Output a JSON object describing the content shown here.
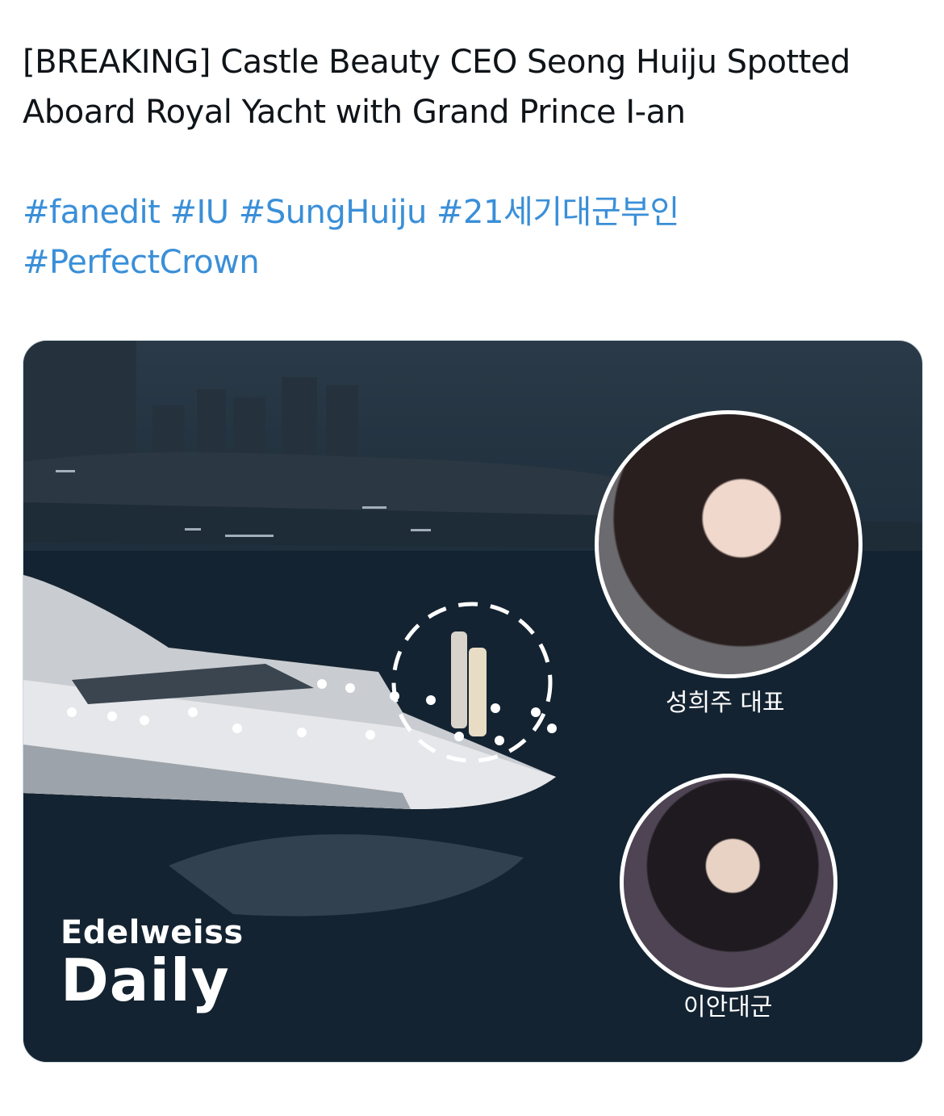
{
  "tweet": {
    "headline_line1": "[BREAKING] Castle Beauty CEO Seong Huiju Spotted",
    "headline_line2": "Aboard Royal Yacht with Grand Prince I-an",
    "hashtags_line1": [
      "#fanedit",
      "#IU",
      "#SungHuiju",
      "#21세기대군부인"
    ],
    "hashtags_line2": [
      "#PerfectCrown"
    ],
    "hashtag_color": "#3a8fd8"
  },
  "media": {
    "portrait_ceo_caption": "성희주 대표",
    "portrait_prince_caption": "이안대군",
    "brand_top": "Edelweiss",
    "brand_bottom": "Daily"
  }
}
